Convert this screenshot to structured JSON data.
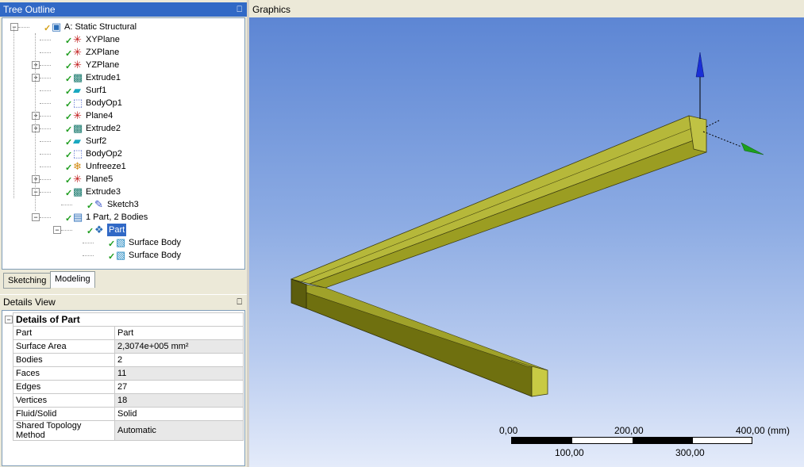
{
  "tree_outline": {
    "title": "Tree Outline",
    "pin": "⎕",
    "items": [
      {
        "label": "A: Static Structural",
        "icon": "static-structural-icon",
        "depth": 0,
        "expand": "−",
        "check": "✓"
      },
      {
        "label": "XYPlane",
        "icon": "plane-axes-icon",
        "depth": 1,
        "expand": "",
        "check": "✓"
      },
      {
        "label": "ZXPlane",
        "icon": "plane-axes-icon",
        "depth": 1,
        "expand": "",
        "check": "✓"
      },
      {
        "label": "YZPlane",
        "icon": "plane-axes-icon",
        "depth": 1,
        "expand": "+",
        "check": "✓"
      },
      {
        "label": "Extrude1",
        "icon": "extrude-icon",
        "depth": 1,
        "expand": "+",
        "check": "✓"
      },
      {
        "label": "Surf1",
        "icon": "surface-icon",
        "depth": 1,
        "expand": "",
        "check": "✓"
      },
      {
        "label": "BodyOp1",
        "icon": "body-operation-icon",
        "depth": 1,
        "expand": "",
        "check": "✓"
      },
      {
        "label": "Plane4",
        "icon": "plane-axes-icon",
        "depth": 1,
        "expand": "+",
        "check": "✓"
      },
      {
        "label": "Extrude2",
        "icon": "extrude-icon",
        "depth": 1,
        "expand": "+",
        "check": "✓"
      },
      {
        "label": "Surf2",
        "icon": "surface-icon",
        "depth": 1,
        "expand": "",
        "check": "✓"
      },
      {
        "label": "BodyOp2",
        "icon": "body-operation-icon",
        "depth": 1,
        "expand": "",
        "check": "✓"
      },
      {
        "label": "Unfreeze1",
        "icon": "unfreeze-icon",
        "depth": 1,
        "expand": "",
        "check": "✓"
      },
      {
        "label": "Plane5",
        "icon": "plane-axes-icon",
        "depth": 1,
        "expand": "+",
        "check": "✓"
      },
      {
        "label": "Extrude3",
        "icon": "extrude-icon",
        "depth": 1,
        "expand": "−",
        "check": "✓"
      },
      {
        "label": "Sketch3",
        "icon": "sketch-icon",
        "depth": 2,
        "expand": "",
        "check": "✓"
      },
      {
        "label": "1 Part, 2 Bodies",
        "icon": "parts-bodies-icon",
        "depth": 1,
        "expand": "−",
        "check": "✓"
      },
      {
        "label": "Part",
        "icon": "part-icon",
        "depth": 2,
        "expand": "−",
        "check": "✓",
        "selected": true
      },
      {
        "label": "Surface Body",
        "icon": "surface-body-icon",
        "depth": 3,
        "expand": "",
        "check": "✓"
      },
      {
        "label": "Surface Body",
        "icon": "surface-body-icon",
        "depth": 3,
        "expand": "",
        "check": "✓"
      }
    ]
  },
  "tabs": [
    {
      "label": "Sketching",
      "active": false
    },
    {
      "label": "Modeling",
      "active": true
    }
  ],
  "details_view": {
    "title": "Details View",
    "pin": "⎕",
    "section": "Details of Part",
    "expand": "−",
    "rows": [
      {
        "key": "Part",
        "value": "Part"
      },
      {
        "key": "Surface Area",
        "value": "2,3074e+005 mm²"
      },
      {
        "key": "Bodies",
        "value": "2"
      },
      {
        "key": "Faces",
        "value": "11"
      },
      {
        "key": "Edges",
        "value": "27"
      },
      {
        "key": "Vertices",
        "value": "18"
      },
      {
        "key": "Fluid/Solid",
        "value": "Solid"
      },
      {
        "key": "Shared Topology Method",
        "value": "Automatic"
      }
    ]
  },
  "graphics": {
    "title": "Graphics",
    "model_color": "#a9ab2c",
    "scale": {
      "top_labels": [
        "0,00",
        "200,00",
        "400,00 (mm)"
      ],
      "bottom_labels": [
        "100,00",
        "300,00"
      ]
    },
    "triad": {
      "y_color": "#1a2fd6",
      "x_color": "#1da01d"
    }
  }
}
